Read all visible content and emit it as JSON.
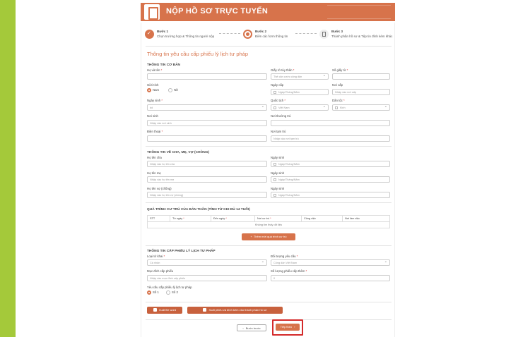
{
  "colors": {
    "accent": "#d7734b",
    "side": "#a4c93a",
    "highlight": "#d42a2a"
  },
  "header": {
    "title": "NỘP HỒ SƠ TRỰC TUYẾN",
    "icon": "document-icon"
  },
  "steps": [
    {
      "label": "Bước 1",
      "desc": "Chọn trường hợp & Thông tin người nộp"
    },
    {
      "label": "Bước 2",
      "desc": "Điền các form thông tin"
    },
    {
      "label": "Bước 3",
      "desc": "Thành phần hồ sơ & Tệp tin đính kèm khác"
    }
  ],
  "form_title": "Thông tin yêu cầu cấp phiếu lý lịch tư pháp",
  "basic": {
    "heading": "THÔNG TIN CƠ BẢN",
    "name": "Họ và tên",
    "id_type": "Giấy tờ tùy thân",
    "id_type_value": "Thẻ căn cước công dân",
    "id_no": "Số giấy tờ",
    "gender": "Giới tính",
    "male": "Nam",
    "female": "Nữ",
    "issue_date": "Ngày cấp",
    "issue_date_ph": "Ngày/Tháng/Năm",
    "issue_place": "Nơi cấp",
    "issue_place_ph": "Nhập vào nơi cấp",
    "dob": "Ngày sinh",
    "dob_value": "dd",
    "nationality": "Quốc tịch",
    "nationality_value": "Việt Nam",
    "ethnic": "Dân tộc",
    "ethnic_value": "Kinh",
    "birthplace": "Nơi sinh",
    "birthplace_ph": "Nhập vào nơi sinh",
    "residence": "Nơi thường trú",
    "phone": "Điện thoại",
    "temp": "Nơi tạm trú",
    "temp_ph": "Nhập vào nơi tạm trú"
  },
  "family": {
    "heading": "THÔNG TIN VỀ CHA, MẸ, VỢ (CHỒNG)",
    "father": "Họ tên cha",
    "father_ph": "Nhập vào họ tên cha",
    "mother": "Họ tên mẹ",
    "mother_ph": "Nhập vào họ tên mẹ",
    "spouse": "Họ tên vợ (chồng)",
    "spouse_ph": "Nhập vào họ tên vợ (chồng)",
    "dob": "Ngày sinh",
    "dob_ph": "Ngày/Tháng/Năm"
  },
  "residence": {
    "heading": "QUÁ TRÌNH CƯ TRÚ CỦA BẢN THÂN (TÍNH TỪ KHI ĐỦ 14 TUỔI)",
    "columns": [
      "STT",
      "Từ ngày",
      "Đến ngày",
      "Nơi cư trú",
      "Công việc",
      "Nơi làm việc"
    ],
    "empty": "Không tìm thấy dữ liệu",
    "add": "Thêm mới quá trình cư trú"
  },
  "request": {
    "heading": "THÔNG TIN CẤP PHIẾU LÝ LỊCH TƯ PHÁP",
    "type": "Loại tờ khai",
    "type_value": "Cá nhân",
    "subject": "Đối tượng yêu cầu",
    "subject_value": "Công dân Việt Nam",
    "purpose": "Mục đích cấp phiếu",
    "purpose_ph": "Nhập vào mục đích cấp phiếu",
    "copies": "Số lượng phiếu cấp thêm",
    "copies_value": "0",
    "form_req": "Yêu cầu cấp phiếu lý lịch tư pháp",
    "opt1": "Số 1",
    "opt2": "Số 2"
  },
  "actions": {
    "export": "Xuất file word",
    "export2": "Xuất phiếu và đính kèm vào thành phần hồ sơ",
    "back": "Bước trước",
    "next": "Tiếp theo"
  }
}
